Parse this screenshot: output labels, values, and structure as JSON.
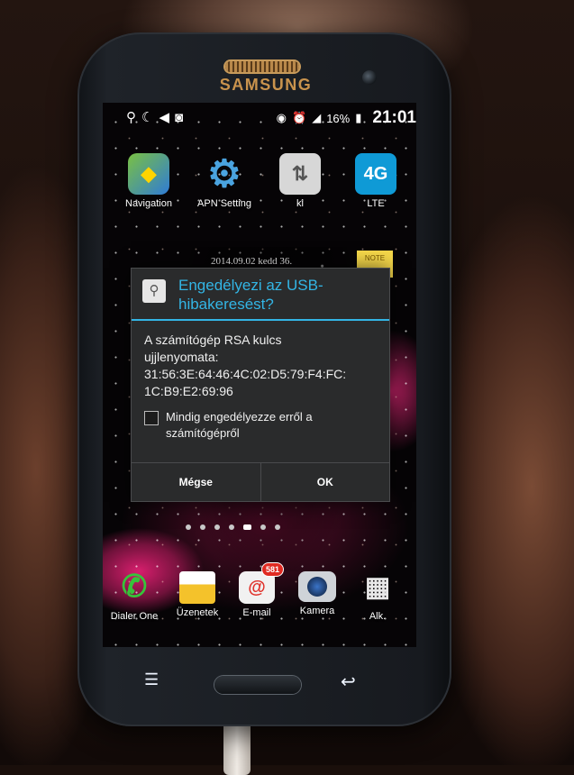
{
  "phone": {
    "brand": "SAMSUNG"
  },
  "statusbar": {
    "left_icons": [
      "usb-icon",
      "moon-icon",
      "sound-icon",
      "screenshot-icon"
    ],
    "battery": "16%",
    "time": "21:01"
  },
  "home": {
    "row1": [
      {
        "label": "Navigation",
        "icon": "navigation-icon"
      },
      {
        "label": "APN Setting",
        "icon": "gear-icon"
      },
      {
        "label": "ki",
        "icon": "data-toggle-icon"
      },
      {
        "label": "LTE",
        "icon": "lte-icon",
        "badge": "4G"
      }
    ],
    "widget_date": "2014.09.02 kedd 36.",
    "note_label": "NOTE",
    "dock": [
      {
        "label": "Dialer One",
        "icon": "phone-icon"
      },
      {
        "label": "Üzenetek",
        "icon": "message-icon"
      },
      {
        "label": "E-mail",
        "icon": "email-icon",
        "badge": "581"
      },
      {
        "label": "Kamera",
        "icon": "camera-icon"
      },
      {
        "label": "Alk.",
        "icon": "apps-grid-icon"
      }
    ]
  },
  "dialog": {
    "title": "Engedélyezi az USB-hibakeresést?",
    "message_line1": "A számítógép RSA kulcs",
    "message_line2": "ujjlenyomata:",
    "fingerprint_line1": "31:56:3E:64:46:4C:02:D5:79:F4:FC:",
    "fingerprint_line2": "1C:B9:E2:69:96",
    "checkbox_label": "Mindig engedélyezze erről a számítógépről",
    "cancel_label": "Mégse",
    "ok_label": "OK"
  }
}
